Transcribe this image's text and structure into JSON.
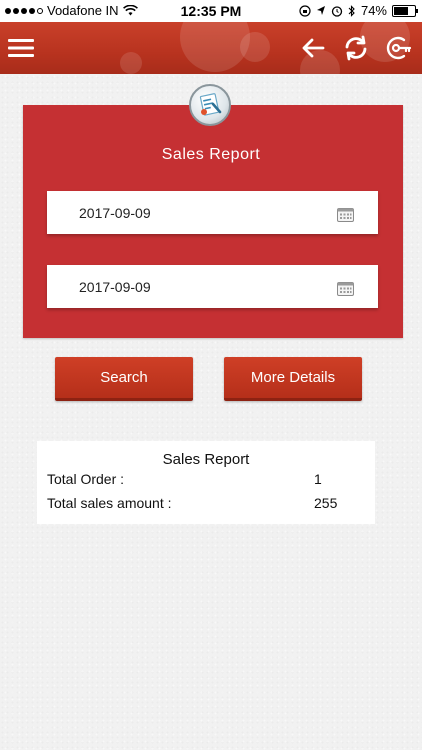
{
  "status_bar": {
    "carrier": "Vodafone IN",
    "time": "12:35 PM",
    "battery": "74%",
    "battery_level": 0.74
  },
  "header": {
    "menu_icon": "hamburger-menu-icon",
    "back_icon": "back-arrow-icon",
    "refresh_icon": "refresh-icon",
    "logout_icon": "logout-key-icon",
    "color": "#b8331f"
  },
  "report": {
    "title": "Sales Report",
    "from_date": "2017-09-09",
    "to_date": "2017-09-09",
    "card_color": "#c53033"
  },
  "buttons": {
    "search": "Search",
    "more_details": "More Details"
  },
  "summary": {
    "title": "Sales Report",
    "total_order_label": "Total Order :",
    "total_order_value": "1",
    "total_sales_label": "Total sales amount :",
    "total_sales_value": "255"
  }
}
